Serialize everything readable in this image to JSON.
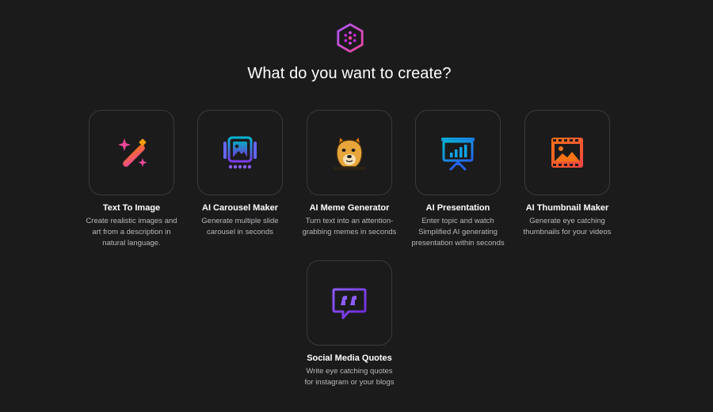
{
  "header": {
    "logo_icon": "brand-hexagon-logo-icon",
    "title": "What do you want to create?"
  },
  "cards": [
    {
      "icon": "magic-wand-icon",
      "title": "Text To Image",
      "desc": [
        "Create realistic images and",
        "art from a description in",
        "natural language."
      ]
    },
    {
      "icon": "carousel-icon",
      "title": "AI Carousel Maker",
      "desc": [
        "Generate multiple slide",
        "carousel in seconds"
      ]
    },
    {
      "icon": "doge-meme-icon",
      "title": "AI Meme Generator",
      "desc": [
        "Turn text into an attention-",
        "grabbing memes in seconds"
      ]
    },
    {
      "icon": "presentation-board-icon",
      "title": "AI Presentation",
      "desc": [
        "Enter topic and watch",
        "Simplified AI generating",
        "presentation within seconds"
      ]
    },
    {
      "icon": "film-thumbnail-icon",
      "title": "AI Thumbnail Maker",
      "desc": [
        "Generate eye catching",
        "thumbnails for your videos"
      ]
    },
    {
      "icon": "quote-bubble-icon",
      "title": "Social Media Quotes",
      "desc": [
        "Write eye catching quotes",
        "for instagram or your blogs"
      ]
    }
  ],
  "colors": {
    "background": "#1b1b1c",
    "tile_border": "#3a3a3d",
    "accent_pink": "#ec4899",
    "accent_purple": "#8b5cf6",
    "accent_blue": "#2563eb",
    "accent_cyan": "#06b6d4",
    "accent_orange": "#f97316"
  }
}
